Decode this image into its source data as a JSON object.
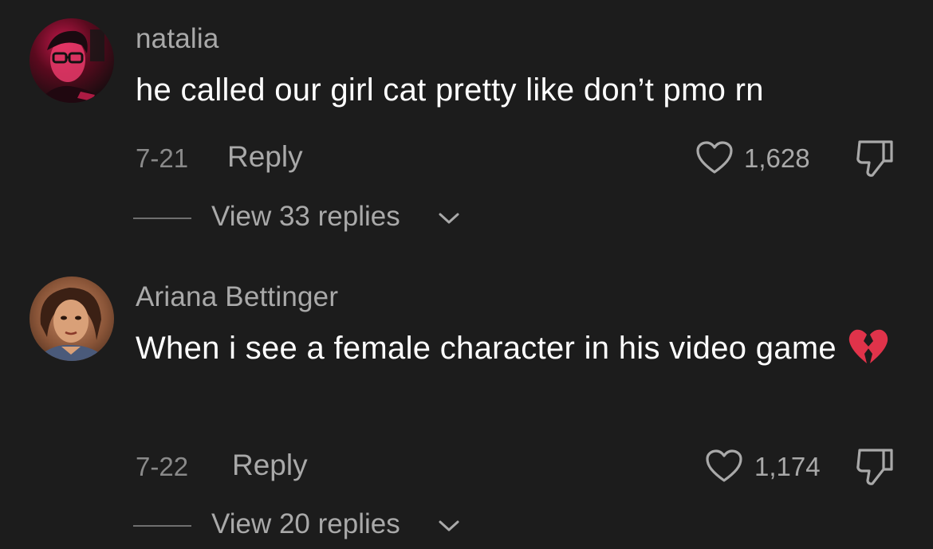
{
  "comments": [
    {
      "username": "natalia",
      "text": "he called our girl cat pretty like don’t pmo rn",
      "date": "7-21",
      "reply_label": "Reply",
      "likes": "1,628",
      "view_replies_label": "View 33 replies",
      "avatar_icon": "profile-photo-red-tint"
    },
    {
      "username": "Ariana Bettinger",
      "text": "When i see a female character in his video game",
      "emoji": "broken-heart-icon",
      "date": "7-22",
      "reply_label": "Reply",
      "likes": "1,174",
      "view_replies_label": "View 20 replies",
      "avatar_icon": "profile-photo-warm"
    }
  ],
  "colors": {
    "background": "#1c1c1c",
    "username": "#a9a9a9",
    "text": "#ffffff",
    "meta": "#8a8a8a",
    "emoji": "#e0334a"
  }
}
